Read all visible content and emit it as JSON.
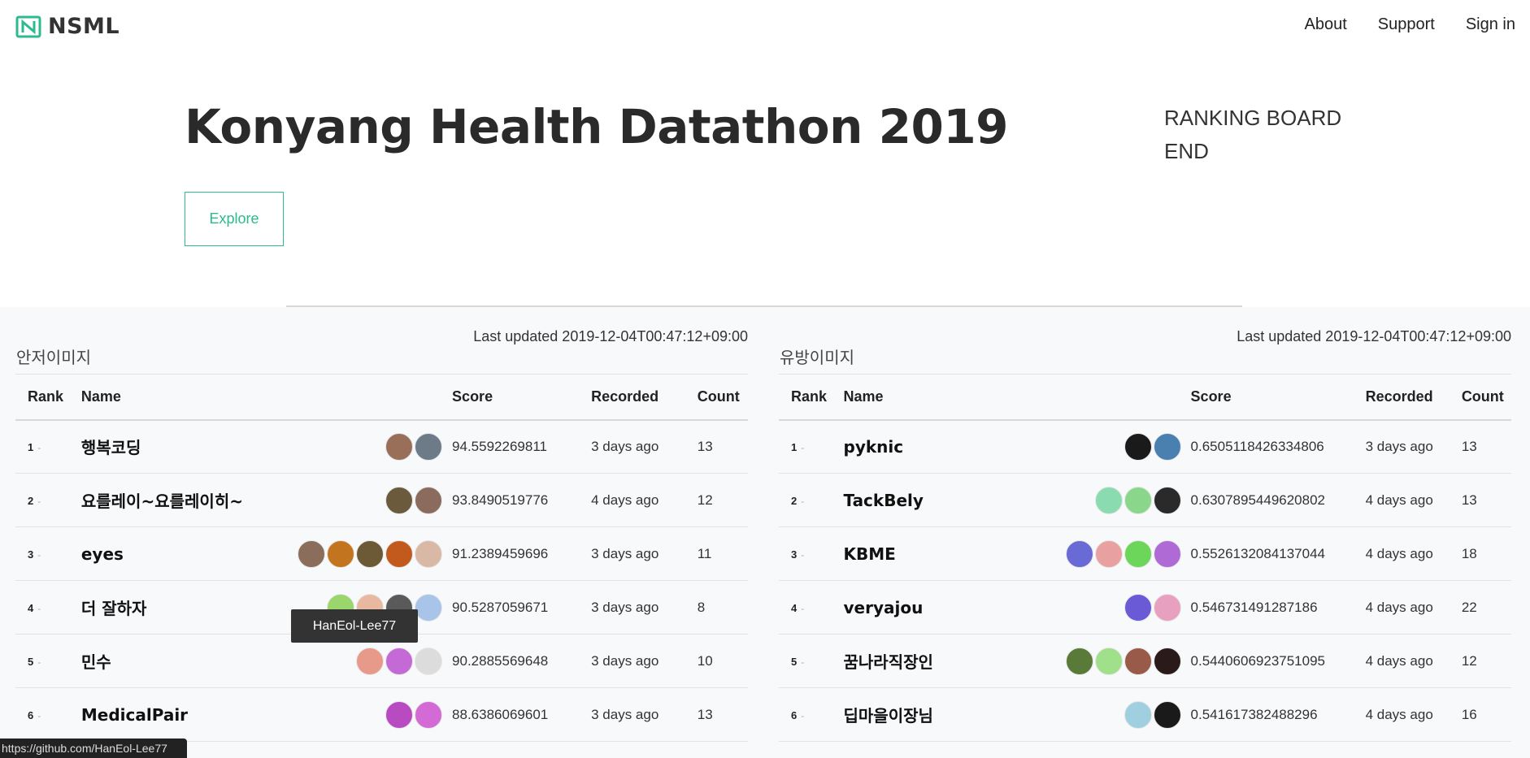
{
  "brand": {
    "name": "NSML",
    "accent": "#2bbb8f"
  },
  "nav": {
    "about": "About",
    "support": "Support",
    "signin": "Sign in"
  },
  "hero": {
    "title": "Konyang Health Datathon 2019",
    "status_line1": "RANKING BOARD",
    "status_line2": "END",
    "explore_label": "Explore"
  },
  "columns": {
    "rank": "Rank",
    "name": "Name",
    "score": "Score",
    "recorded": "Recorded",
    "count": "Count"
  },
  "boards": [
    {
      "title": "안저이미지",
      "updated": "Last updated 2019-12-04T00:47:12+09:00",
      "rows": [
        {
          "rank": "1",
          "name": "행복코딩",
          "score": "94.5592269811",
          "recorded": "3 days ago",
          "count": "13",
          "avatars": [
            "#9a6f5a",
            "#6d7b88"
          ]
        },
        {
          "rank": "2",
          "name": "요를레이~요를레이히~",
          "score": "93.8490519776",
          "recorded": "4 days ago",
          "count": "12",
          "avatars": [
            "#6b5a3c",
            "#8a6b5e"
          ]
        },
        {
          "rank": "3",
          "name": "eyes",
          "score": "91.2389459696",
          "recorded": "3 days ago",
          "count": "11",
          "avatars": [
            "#8a6d5a",
            "#c2751e",
            "#6b5a35",
            "#c25a1e",
            "#d9b9a6"
          ]
        },
        {
          "rank": "4",
          "name": "더 잘하자",
          "score": "90.5287059671",
          "recorded": "3 days ago",
          "count": "8",
          "avatars": [
            "#9ad66b",
            "#e8b9a0",
            "#5a5a5a",
            "#a8c4e8"
          ]
        },
        {
          "rank": "5",
          "name": "민수",
          "score": "90.2885569648",
          "recorded": "3 days ago",
          "count": "10",
          "avatars": [
            "#e89a8a",
            "#c46ad6",
            "#dcdcdc"
          ]
        },
        {
          "rank": "6",
          "name": "MedicalPair",
          "score": "88.6386069601",
          "recorded": "3 days ago",
          "count": "13",
          "avatars": [
            "#b84bc2",
            "#d46ad6"
          ]
        }
      ]
    },
    {
      "title": "유방이미지",
      "updated": "Last updated 2019-12-04T00:47:12+09:00",
      "rows": [
        {
          "rank": "1",
          "name": "pyknic",
          "score": "0.6505118426334806",
          "recorded": "3 days ago",
          "count": "13",
          "avatars": [
            "#1a1a1a",
            "#4a80b0"
          ]
        },
        {
          "rank": "2",
          "name": "TackBely",
          "score": "0.6307895449620802",
          "recorded": "4 days ago",
          "count": "13",
          "avatars": [
            "#8adcb0",
            "#8ad68a",
            "#2a2a2a"
          ]
        },
        {
          "rank": "3",
          "name": "KBME",
          "score": "0.5526132084137044",
          "recorded": "4 days ago",
          "count": "18",
          "avatars": [
            "#6a6ad6",
            "#e8a0a0",
            "#6bd65a",
            "#b06ad6"
          ]
        },
        {
          "rank": "4",
          "name": "veryajou",
          "score": "0.546731491287186",
          "recorded": "4 days ago",
          "count": "22",
          "avatars": [
            "#6a5ad6",
            "#e8a0c0"
          ]
        },
        {
          "rank": "5",
          "name": "꿈나라직장인",
          "score": "0.5440606923751095",
          "recorded": "4 days ago",
          "count": "12",
          "avatars": [
            "#5a7a3a",
            "#a0e08a",
            "#9a5a4a",
            "#2a1a1a"
          ]
        },
        {
          "rank": "6",
          "name": "딥마을이장님",
          "score": "0.541617382488296",
          "recorded": "4 days ago",
          "count": "16",
          "avatars": [
            "#a0d0e0",
            "#1a1a1a"
          ]
        }
      ]
    }
  ],
  "tooltip": "HanEol-Lee77",
  "status_url": "https://github.com/HanEol-Lee77"
}
